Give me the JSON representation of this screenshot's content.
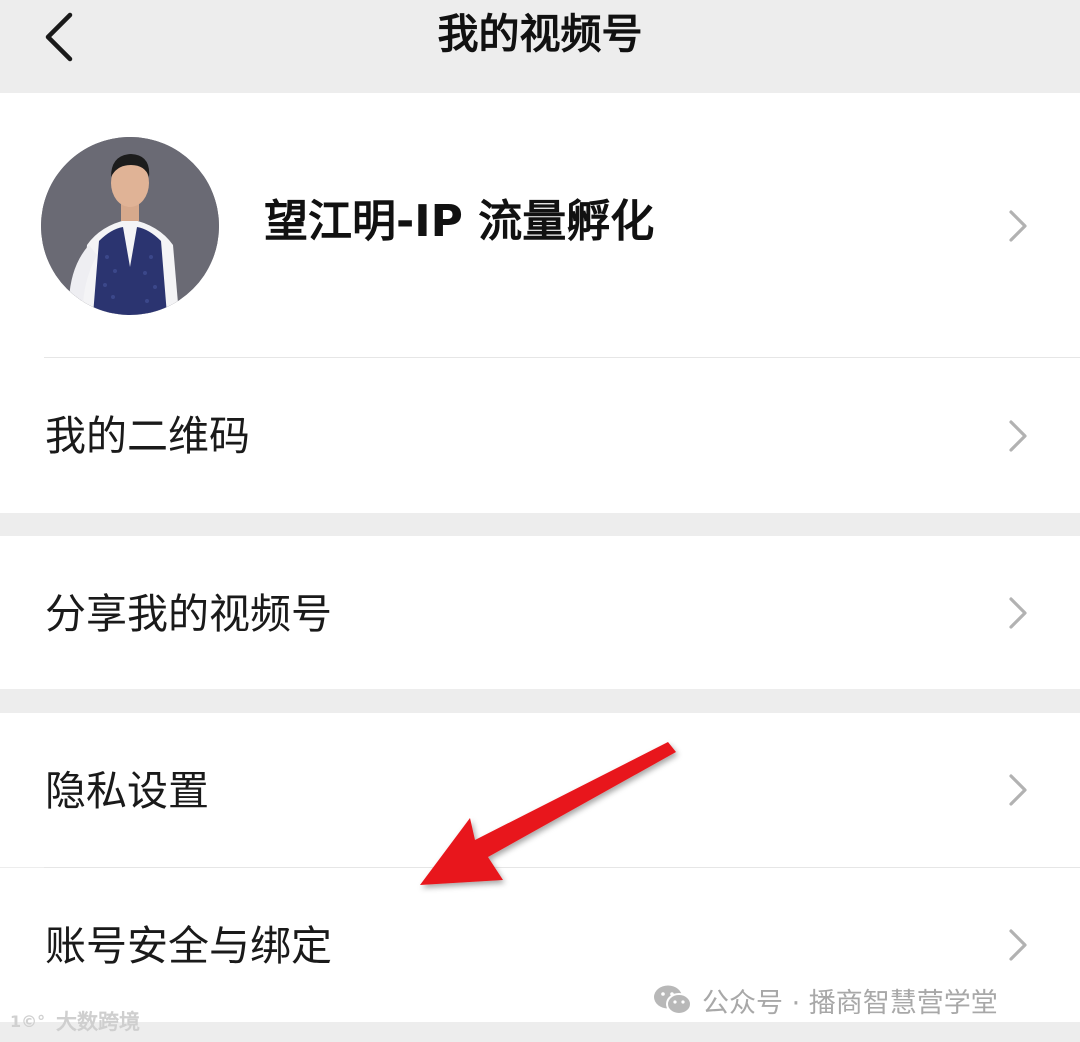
{
  "header": {
    "title": "我的视频号",
    "back_icon": "chevron-left-icon"
  },
  "profile": {
    "name": "望江明-IP 流量孵化",
    "avatar_icon": "avatar"
  },
  "menu": {
    "qr_code": "我的二维码",
    "share": "分享我的视频号",
    "privacy": "隐私设置",
    "account_security": "账号安全与绑定"
  },
  "annotation": {
    "arrow_color": "#e8191c",
    "arrow_icon": "red-arrow-icon"
  },
  "watermarks": {
    "wechat_source": "公众号 · 播商智慧营学堂",
    "bottom_left": "大数跨境"
  },
  "colors": {
    "background": "#ededed",
    "cell": "#ffffff",
    "chevron": "#b2b2b2"
  }
}
